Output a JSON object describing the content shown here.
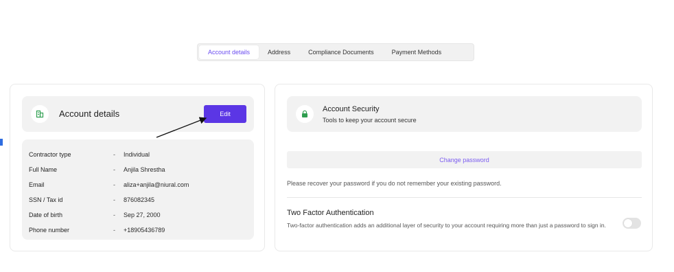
{
  "tabs": [
    {
      "label": "Account details",
      "active": true
    },
    {
      "label": "Address",
      "active": false
    },
    {
      "label": "Compliance Documents",
      "active": false
    },
    {
      "label": "Payment Methods",
      "active": false
    }
  ],
  "account": {
    "title": "Account details",
    "icon": "building-icon",
    "edit_label": "Edit",
    "rows": [
      {
        "label": "Contractor type",
        "value": "Individual"
      },
      {
        "label": "Full Name",
        "value": "Anjila Shrestha"
      },
      {
        "label": "Email",
        "value": "aliza+anjila@niural.com"
      },
      {
        "label": "SSN / Tax id",
        "value": "876082345"
      },
      {
        "label": "Date of birth",
        "value": "Sep 27, 2000"
      },
      {
        "label": "Phone number",
        "value": "+18905436789"
      }
    ],
    "separator": "-"
  },
  "security": {
    "title": "Account Security",
    "subtitle": "Tools to keep your account secure",
    "icon": "lock-icon",
    "change_password_label": "Change password",
    "recover_note": "Please recover your password if you do not remember your existing password.",
    "tfa_title": "Two Factor Authentication",
    "tfa_description": "Two-factor authentication adds an additional layer of security to your account requiring more than just a password to sign in.",
    "tfa_enabled": false
  },
  "colors": {
    "accent": "#5b36e5",
    "accent_text": "#7b5cf0",
    "panel_bg": "#f2f2f2",
    "icon_green": "#2e9e4f",
    "marker_blue": "#2f6de0"
  }
}
